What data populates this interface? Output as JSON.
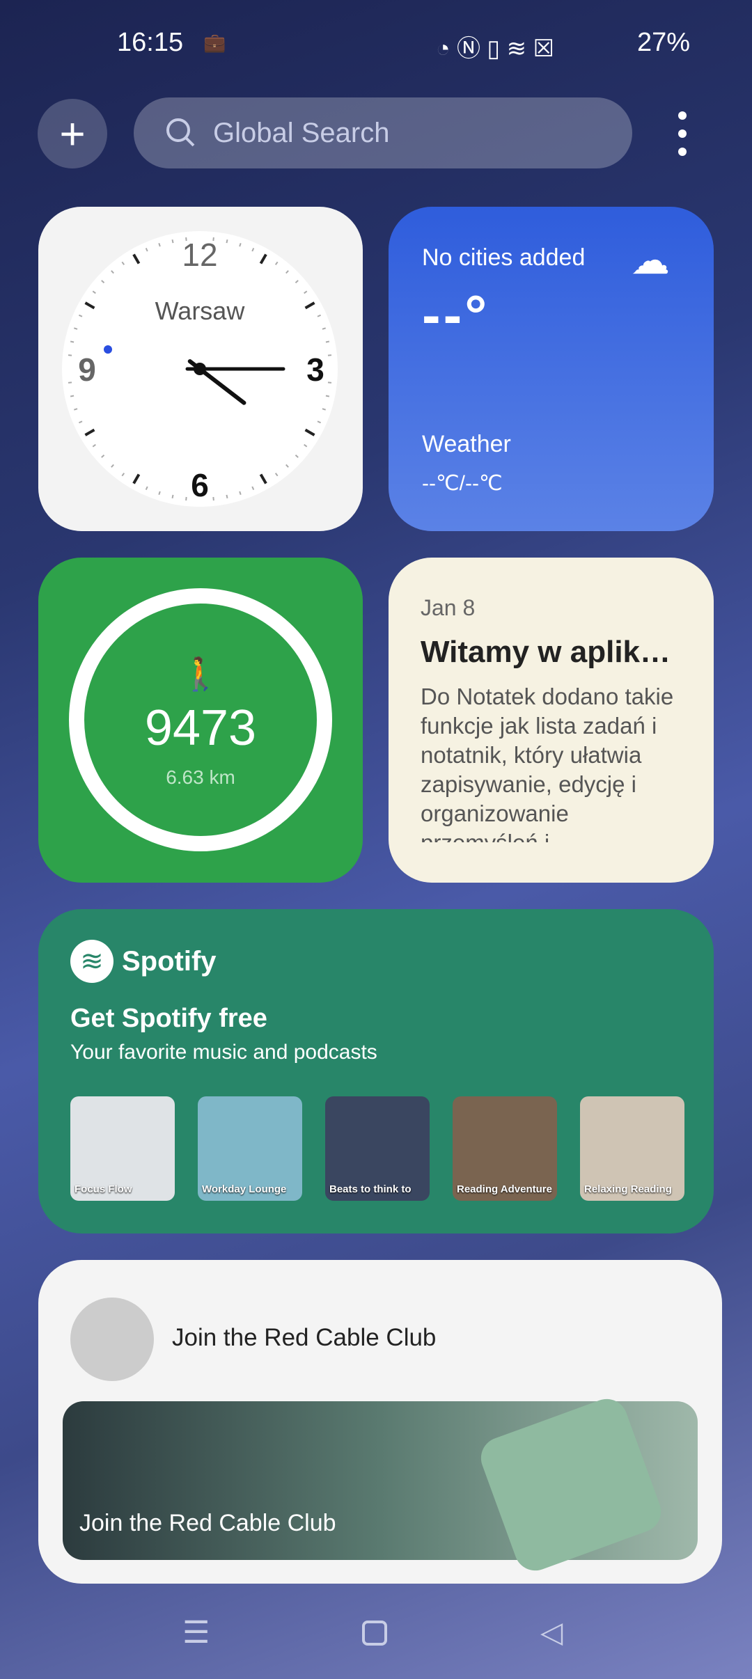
{
  "status": {
    "time": "16:15",
    "battery": "27%"
  },
  "topbar": {
    "search_placeholder": "Global Search"
  },
  "clock": {
    "city": "Warsaw",
    "numerals": [
      "12",
      "3",
      "6",
      "9"
    ],
    "hour": 16,
    "minute": 15
  },
  "weather": {
    "title": "No cities added",
    "temp": "--°",
    "label": "Weather",
    "range": "--℃/--℃"
  },
  "steps": {
    "count": "9473",
    "distance": "6.63 km"
  },
  "notes": {
    "date": "Jan 8",
    "title": "Witamy w aplik…",
    "body": "Do Notatek dodano takie funkcje jak lista zadań i notatnik, który ułatwia zapisywanie, edycję i organizowanie przemyśleń i"
  },
  "spotify": {
    "brand": "Spotify",
    "title": "Get Spotify free",
    "subtitle": "Your favorite music and podcasts",
    "playlists": [
      {
        "label": "Focus Flow",
        "color": "#dfe3e6"
      },
      {
        "label": "Workday Lounge",
        "color": "#7fb7c8"
      },
      {
        "label": "Beats to think to",
        "color": "#3a4660"
      },
      {
        "label": "Reading Adventure",
        "color": "#7a6450"
      },
      {
        "label": "Relaxing Reading",
        "color": "#cfc4b4"
      }
    ]
  },
  "club": {
    "title": "Join the Red Cable Club",
    "banner": "Join the Red Cable Club"
  }
}
